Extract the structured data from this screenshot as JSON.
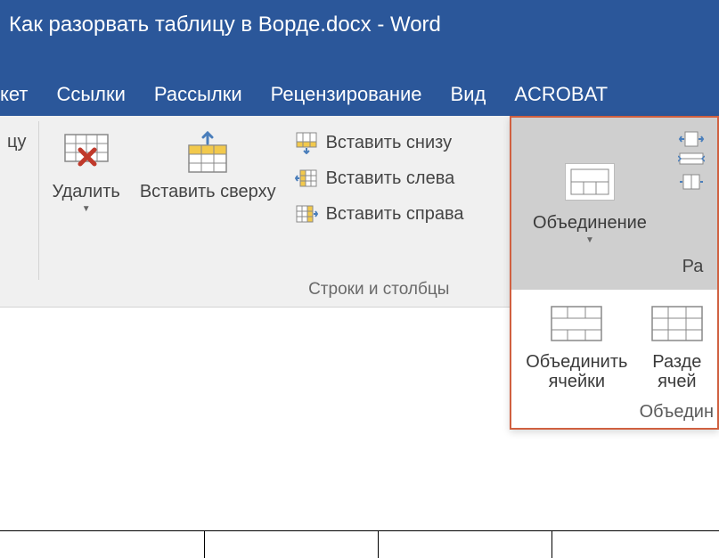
{
  "title": "Как разорвать таблицу в Ворде.docx - Word",
  "tabs": {
    "maket": "кет",
    "links": "Ссылки",
    "mailings": "Рассылки",
    "review": "Рецензирование",
    "view": "Вид",
    "acrobat": "ACROBAT"
  },
  "ribbon": {
    "partial_btn": "цу",
    "delete": "Удалить",
    "insert_above": "Вставить сверху",
    "insert_below": "Вставить снизу",
    "insert_left": "Вставить слева",
    "insert_right": "Вставить справа",
    "rows_cols_group": "Строки и столбцы",
    "merge_split_btn": "Объединение",
    "size_partial": "Ра"
  },
  "merge_panel": {
    "merge_cells": "Объединить ячейки",
    "split_cells": "Разде ячей",
    "group_label": "Объедин"
  }
}
